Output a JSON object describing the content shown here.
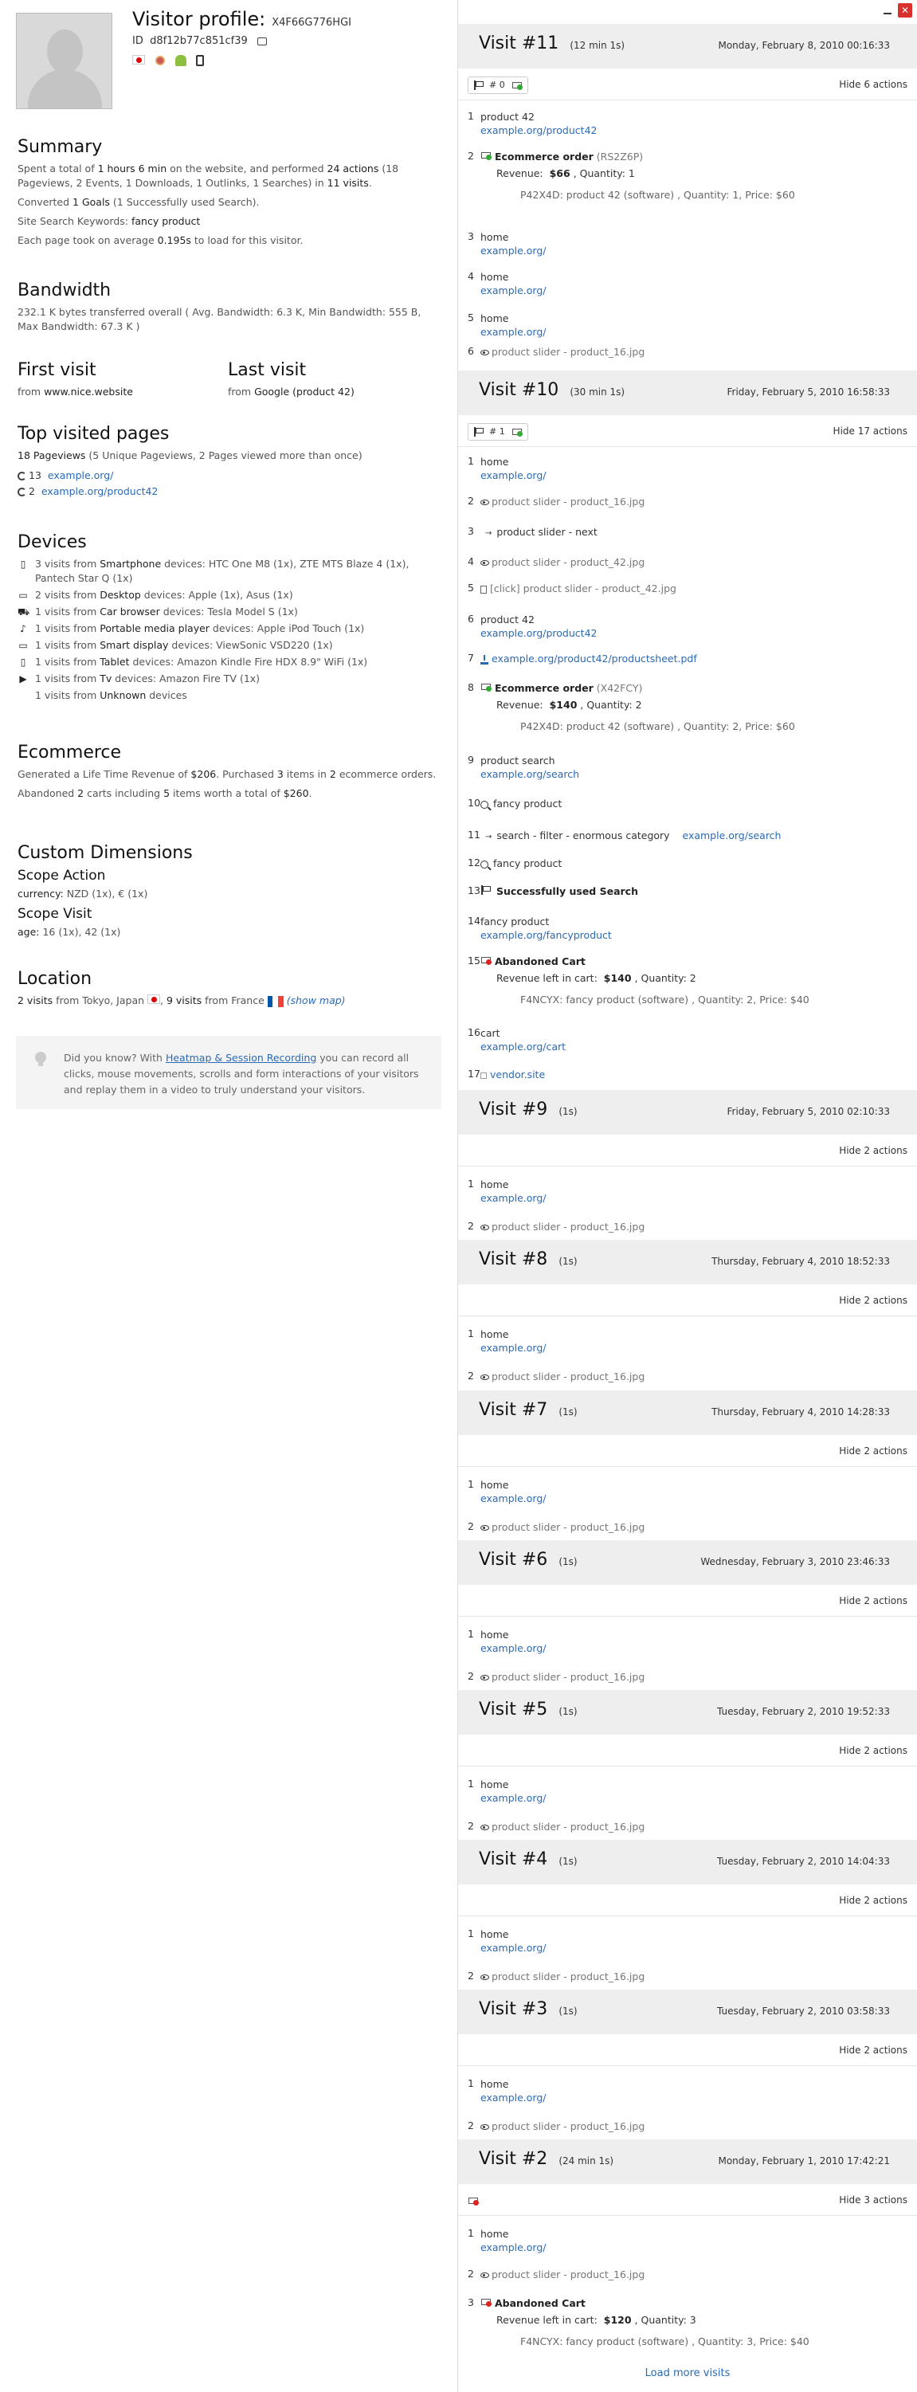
{
  "profile": {
    "title": "Visitor profile:",
    "visitor_id": "X4F66G776HGI",
    "id_label": "ID",
    "id_value": "d8f12b77c851cf39"
  },
  "summary": {
    "heading": "Summary",
    "line1_pre": "Spent a total of ",
    "line1_time": "1 hours 6 min",
    "line1_mid": " on the website, and performed ",
    "line1_actions": "24 actions",
    "line1_post": " (18 Pageviews, 2 Events, 1 Downloads, 1 Outlinks, 1 Searches) in ",
    "line1_visits": "11 visits",
    "line1_end": ".",
    "goals_pre": "Converted ",
    "goals_count": "1 Goals",
    "goals_post": " (1 Successfully used Search).",
    "kw_pre": "Site Search Keywords: ",
    "kw_value": "fancy product",
    "load_pre": "Each page took on average ",
    "load_value": "0.195s",
    "load_post": " to load for this visitor."
  },
  "bandwidth": {
    "heading": "Bandwidth",
    "text": "232.1 K bytes transferred overall ( Avg. Bandwidth: 6.3 K, Min Bandwidth: 555 B, Max Bandwidth: 67.3 K )"
  },
  "first_visit": {
    "heading": "First visit",
    "from": "from ",
    "source": "www.nice.website"
  },
  "last_visit": {
    "heading": "Last visit",
    "from": "from ",
    "source": "Google (product 42)"
  },
  "top_pages": {
    "heading": "Top visited pages",
    "summary_bold": "18 Pageviews",
    "summary_rest": " (5 Unique Pageviews, 2 Pages viewed more than once)",
    "items": [
      {
        "count": "13",
        "url": "example.org/"
      },
      {
        "count": "2",
        "url": "example.org/product42"
      }
    ]
  },
  "devices": {
    "heading": "Devices",
    "rows": [
      {
        "icon": "smartphone-icon",
        "glyph": "▯",
        "count": "3 visits from ",
        "type": "Smartphone",
        "rest": " devices: HTC One M8 (1x), ZTE MTS Blaze 4 (1x), Pantech Star Q (1x)"
      },
      {
        "icon": "desktop-icon",
        "glyph": "▭",
        "count": "2 visits from ",
        "type": "Desktop",
        "rest": " devices: Apple (1x), Asus (1x)"
      },
      {
        "icon": "car-icon",
        "glyph": "⛟",
        "count": "1 visits from ",
        "type": "Car browser",
        "rest": " devices: Tesla Model S (1x)"
      },
      {
        "icon": "media-player-icon",
        "glyph": "♪",
        "count": "1 visits from ",
        "type": "Portable media player",
        "rest": " devices: Apple iPod Touch (1x)"
      },
      {
        "icon": "smart-display-icon",
        "glyph": "▭",
        "count": "1 visits from ",
        "type": "Smart display",
        "rest": " devices: ViewSonic VSD220 (1x)"
      },
      {
        "icon": "tablet-icon",
        "glyph": "▯",
        "count": "1 visits from ",
        "type": "Tablet",
        "rest": " devices: Amazon Kindle Fire HDX 8.9\" WiFi (1x)"
      },
      {
        "icon": "tv-icon",
        "glyph": "▶",
        "count": "1 visits from ",
        "type": "Tv",
        "rest": " devices: Amazon Fire TV (1x)"
      },
      {
        "icon": "",
        "glyph": "",
        "count": "1 visits from ",
        "type": "Unknown",
        "rest": " devices"
      }
    ]
  },
  "ecommerce": {
    "heading": "Ecommerce",
    "line1_pre": "Generated a Life Time Revenue of ",
    "revenue": "$206",
    "line1_mid": ". Purchased ",
    "items": "3",
    "line1_mid2": " items in ",
    "orders": "2",
    "line1_post": " ecommerce orders.",
    "line2_pre": "Abandoned ",
    "carts": "2",
    "line2_mid": " carts including ",
    "cart_items": "5",
    "line2_mid2": " items worth a total of ",
    "cart_total": "$260",
    "line2_post": "."
  },
  "custom_dimensions": {
    "heading": "Custom Dimensions",
    "scope_action": "Scope Action",
    "currency_label": "currency:",
    "currency_value": " NZD (1x), € (1x)",
    "scope_visit": "Scope Visit",
    "age_label": "age:",
    "age_value": " 16 (1x), 42 (1x)"
  },
  "location": {
    "heading": "Location",
    "count1": "2 visits",
    "from1": " from Tokyo, Japan ",
    "count2": "9 visits",
    "from2": " from France ",
    "show_map": "(show map)"
  },
  "tip": {
    "pre": "Did you know? With ",
    "link": "Heatmap & Session Recording",
    "post": " you can record all clicks, mouse movements, scrolls and form interactions of your visitors and replay them in a video to truly understand your visitors."
  },
  "visits": [
    {
      "title": "Visit #11",
      "duration": "(12 min 1s)",
      "date": "Monday, February 8, 2010 00:16:33",
      "goals": "# 0",
      "hide": "Hide 6 actions",
      "actions": [
        {
          "n": "1",
          "title": "product 42",
          "url": "example.org/product42"
        },
        {
          "n": "2",
          "ecom": "Ecommerce order",
          "ecom_id": "(RS2Z6P)",
          "rev_label": "Revenue:",
          "rev": "$66",
          "qty": ", Quantity: 1",
          "detail": "P42X4D: product 42 (software) , Quantity: 1, Price: $60"
        },
        {
          "n": "3",
          "title": "home",
          "url": "example.org/"
        },
        {
          "n": "4",
          "title": "home",
          "url": "example.org/"
        },
        {
          "n": "5",
          "title": "home",
          "url": "example.org/"
        },
        {
          "n": "6",
          "event": "product slider - product_16.jpg"
        }
      ]
    },
    {
      "title": "Visit #10",
      "duration": "(30 min 1s)",
      "date": "Friday, February 5, 2010 16:58:33",
      "goals": "# 1",
      "hide": "Hide 17 actions",
      "actions": [
        {
          "n": "1",
          "title": "home",
          "url": "example.org/"
        },
        {
          "n": "2",
          "event": "product slider - product_16.jpg"
        },
        {
          "n": "3",
          "arrow": "product slider - next"
        },
        {
          "n": "4",
          "event": "product slider - product_42.jpg"
        },
        {
          "n": "5",
          "click": "[click] product slider - product_42.jpg"
        },
        {
          "n": "6",
          "title": "product 42",
          "url": "example.org/product42"
        },
        {
          "n": "7",
          "download": "example.org/product42/productsheet.pdf"
        },
        {
          "n": "8",
          "ecom": "Ecommerce order",
          "ecom_id": "(X42FCY)",
          "rev_label": "Revenue:",
          "rev": "$140",
          "qty": ", Quantity: 2",
          "detail": "P42X4D: product 42 (software) , Quantity: 2, Price: $60"
        },
        {
          "n": "9",
          "title": "product search",
          "url": "example.org/search"
        },
        {
          "n": "10",
          "search": "fancy product"
        },
        {
          "n": "11",
          "arrow": "search - filter - enormous category",
          "arrow_url": "example.org/search"
        },
        {
          "n": "12",
          "search": "fancy product"
        },
        {
          "n": "13",
          "goal": "Successfully used Search"
        },
        {
          "n": "14",
          "title": "fancy product",
          "url": "example.org/fancyproduct"
        },
        {
          "n": "15",
          "cart": "Abandoned Cart",
          "cart_label": "Revenue left in cart:",
          "cart_rev": "$140",
          "cart_qty": ", Quantity: 2",
          "detail": "F4NCYX: fancy product (software) , Quantity: 2, Price: $40"
        },
        {
          "n": "16",
          "title": "cart",
          "url": "example.org/cart"
        },
        {
          "n": "17",
          "outlink": "vendor.site"
        }
      ]
    },
    {
      "title": "Visit #9",
      "duration": "(1s)",
      "date": "Friday, February 5, 2010 02:10:33",
      "hide": "Hide 2 actions",
      "actions": [
        {
          "n": "1",
          "title": "home",
          "url": "example.org/"
        },
        {
          "n": "2",
          "event": "product slider - product_16.jpg"
        }
      ]
    },
    {
      "title": "Visit #8",
      "duration": "(1s)",
      "date": "Thursday, February 4, 2010 18:52:33",
      "hide": "Hide 2 actions",
      "actions": [
        {
          "n": "1",
          "title": "home",
          "url": "example.org/"
        },
        {
          "n": "2",
          "event": "product slider - product_16.jpg"
        }
      ]
    },
    {
      "title": "Visit #7",
      "duration": "(1s)",
      "date": "Thursday, February 4, 2010 14:28:33",
      "hide": "Hide 2 actions",
      "actions": [
        {
          "n": "1",
          "title": "home",
          "url": "example.org/"
        },
        {
          "n": "2",
          "event": "product slider - product_16.jpg"
        }
      ]
    },
    {
      "title": "Visit #6",
      "duration": "(1s)",
      "date": "Wednesday, February 3, 2010 23:46:33",
      "hide": "Hide 2 actions",
      "actions": [
        {
          "n": "1",
          "title": "home",
          "url": "example.org/"
        },
        {
          "n": "2",
          "event": "product slider - product_16.jpg"
        }
      ]
    },
    {
      "title": "Visit #5",
      "duration": "(1s)",
      "date": "Tuesday, February 2, 2010 19:52:33",
      "hide": "Hide 2 actions",
      "actions": [
        {
          "n": "1",
          "title": "home",
          "url": "example.org/"
        },
        {
          "n": "2",
          "event": "product slider - product_16.jpg"
        }
      ]
    },
    {
      "title": "Visit #4",
      "duration": "(1s)",
      "date": "Tuesday, February 2, 2010 14:04:33",
      "hide": "Hide 2 actions",
      "actions": [
        {
          "n": "1",
          "title": "home",
          "url": "example.org/"
        },
        {
          "n": "2",
          "event": "product slider - product_16.jpg"
        }
      ]
    },
    {
      "title": "Visit #3",
      "duration": "(1s)",
      "date": "Tuesday, February 2, 2010 03:58:33",
      "hide": "Hide 2 actions",
      "actions": [
        {
          "n": "1",
          "title": "home",
          "url": "example.org/"
        },
        {
          "n": "2",
          "event": "product slider - product_16.jpg"
        }
      ]
    },
    {
      "title": "Visit #2",
      "duration": "(24 min 1s)",
      "date": "Monday, February 1, 2010 17:42:21",
      "hide": "Hide 3 actions",
      "actions": [
        {
          "n": "1",
          "title": "home",
          "url": "example.org/"
        },
        {
          "n": "2",
          "event": "product slider - product_16.jpg"
        },
        {
          "n": "3",
          "cart": "Abandoned Cart",
          "cart_label": "Revenue left in cart:",
          "cart_rev": "$120",
          "cart_qty": ", Quantity: 3",
          "detail": "F4NCYX: fancy product (software) , Quantity: 3, Price: $40"
        }
      ]
    }
  ],
  "load_more": "Load more visits",
  "colors": {
    "link": "#2a6ab5",
    "header_bg": "#eeeeee",
    "close": "#d9312b"
  }
}
